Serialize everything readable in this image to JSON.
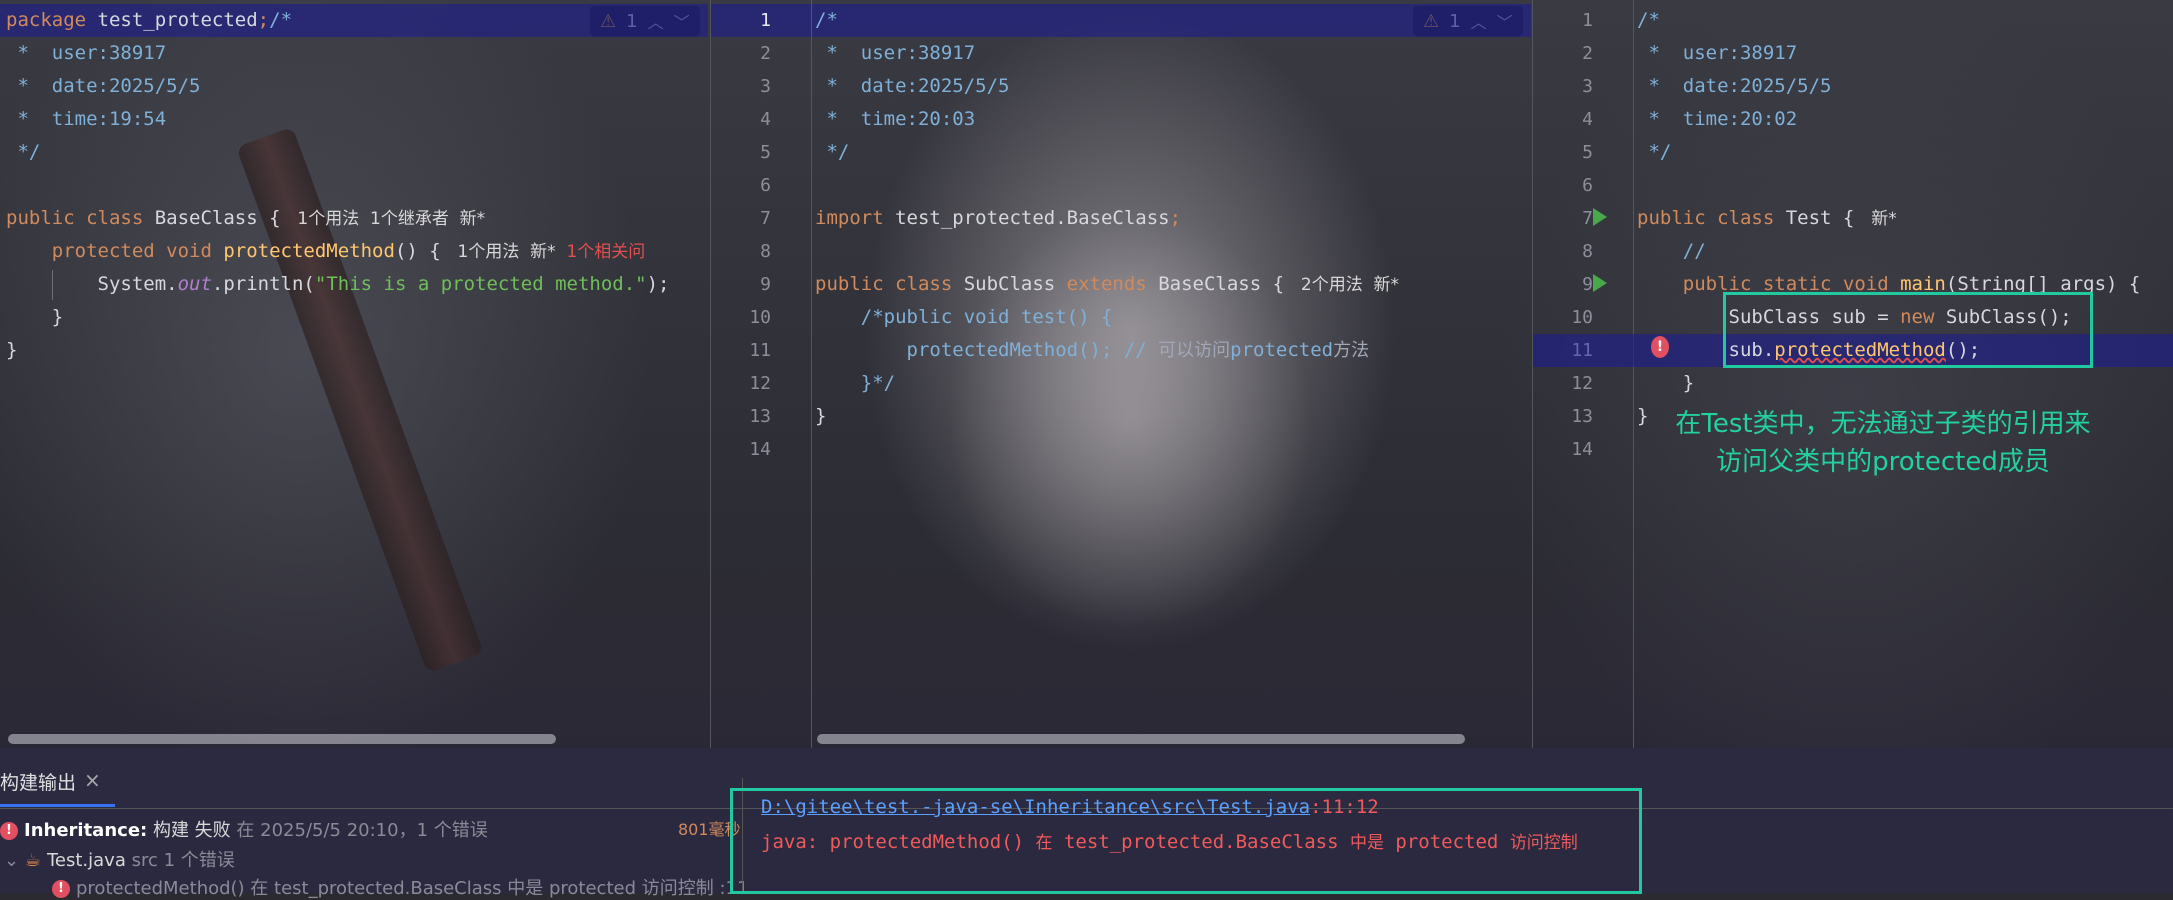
{
  "panes": [
    {
      "id": "baseclass",
      "warning_count": "1",
      "lines": [
        {
          "n": "",
          "segments": [
            [
              "kw",
              "package "
            ],
            [
              "pl",
              "test_protected"
            ],
            [
              "kw",
              ";"
            ],
            [
              "cm",
              "/*"
            ]
          ]
        },
        {
          "n": "",
          "segments": [
            [
              "cm",
              " *  user:38917"
            ]
          ]
        },
        {
          "n": "",
          "segments": [
            [
              "cm",
              " *  date:2025/5/5"
            ]
          ]
        },
        {
          "n": "",
          "segments": [
            [
              "cm",
              " *  time:19:54"
            ]
          ]
        },
        {
          "n": "",
          "segments": [
            [
              "cm",
              " */"
            ]
          ]
        },
        {
          "n": "",
          "segments": []
        },
        {
          "n": "",
          "segments": [
            [
              "kw",
              "public class "
            ],
            [
              "pl",
              "BaseClass { "
            ],
            [
              "hint",
              " 1个用法  1个继承者  新*"
            ]
          ]
        },
        {
          "n": "",
          "segments": [
            [
              "kw",
              "    protected void "
            ],
            [
              "fn",
              "protectedMethod"
            ],
            [
              "pl",
              "() { "
            ],
            [
              "hint",
              " 1个用法  新*"
            ],
            [
              "hintred",
              "  1个相关问"
            ]
          ]
        },
        {
          "n": "",
          "segments": [
            [
              "pl",
              "        System."
            ],
            [
              "it",
              "out"
            ],
            [
              "pl",
              ".println("
            ],
            [
              "st",
              "\"This is a protected method.\""
            ],
            [
              "pl",
              ");"
            ]
          ]
        },
        {
          "n": "",
          "segments": [
            [
              "pl",
              "    }"
            ]
          ]
        },
        {
          "n": "",
          "segments": [
            [
              "pl",
              "}"
            ]
          ]
        }
      ]
    },
    {
      "id": "subclass",
      "warning_count": "1",
      "lines": [
        {
          "n": "1",
          "segments": [
            [
              "cm",
              "/*"
            ]
          ]
        },
        {
          "n": "2",
          "segments": [
            [
              "cm",
              " *  user:38917"
            ]
          ]
        },
        {
          "n": "3",
          "segments": [
            [
              "cm",
              " *  date:2025/5/5"
            ]
          ]
        },
        {
          "n": "4",
          "segments": [
            [
              "cm",
              " *  time:20:03"
            ]
          ]
        },
        {
          "n": "5",
          "segments": [
            [
              "cm",
              " */"
            ]
          ]
        },
        {
          "n": "6",
          "segments": []
        },
        {
          "n": "7",
          "segments": [
            [
              "kw",
              "import "
            ],
            [
              "pl",
              "test_protected.BaseClass"
            ],
            [
              "kw",
              ";"
            ]
          ]
        },
        {
          "n": "8",
          "segments": []
        },
        {
          "n": "9",
          "segments": [
            [
              "kw",
              "public class "
            ],
            [
              "pl",
              "SubClass "
            ],
            [
              "kw",
              "extends "
            ],
            [
              "pl",
              "BaseClass { "
            ],
            [
              "hint",
              " 2个用法  新*"
            ]
          ]
        },
        {
          "n": "10",
          "segments": [
            [
              "cm",
              "    /*public void test() {"
            ]
          ]
        },
        {
          "n": "11",
          "segments": [
            [
              "cm",
              "        protectedMethod(); // "
            ],
            [
              "cjk",
              "可以访问"
            ],
            [
              "cm",
              "protected"
            ],
            [
              "cjk",
              "方法"
            ]
          ]
        },
        {
          "n": "12",
          "segments": [
            [
              "cm",
              "    }*/"
            ]
          ]
        },
        {
          "n": "13",
          "segments": [
            [
              "pl",
              "}"
            ]
          ]
        },
        {
          "n": "14",
          "segments": []
        }
      ]
    },
    {
      "id": "test",
      "lines": [
        {
          "n": "1",
          "segments": [
            [
              "cm",
              "/*"
            ]
          ]
        },
        {
          "n": "2",
          "segments": [
            [
              "cm",
              " *  user:38917"
            ]
          ]
        },
        {
          "n": "3",
          "segments": [
            [
              "cm",
              " *  date:2025/5/5"
            ]
          ]
        },
        {
          "n": "4",
          "segments": [
            [
              "cm",
              " *  time:20:02"
            ]
          ]
        },
        {
          "n": "5",
          "segments": [
            [
              "cm",
              " */"
            ]
          ]
        },
        {
          "n": "6",
          "segments": []
        },
        {
          "n": "7",
          "segments": [
            [
              "kw",
              "public class "
            ],
            [
              "pl",
              "Test { "
            ],
            [
              "hint",
              " 新*"
            ]
          ]
        },
        {
          "n": "8",
          "segments": [
            [
              "cm",
              "    //"
            ]
          ]
        },
        {
          "n": "9",
          "segments": [
            [
              "kw",
              "    public static void "
            ],
            [
              "fn",
              "main"
            ],
            [
              "pl",
              "(String[] args) {"
            ]
          ]
        },
        {
          "n": "10",
          "segments": [
            [
              "pl",
              "        SubClass sub = "
            ],
            [
              "kw",
              "new "
            ],
            [
              "pl",
              "SubClass();"
            ]
          ]
        },
        {
          "n": "11",
          "segments": [
            [
              "pl",
              "        sub."
            ],
            [
              "errtxt",
              "protectedMethod"
            ],
            [
              "pl",
              "();"
            ]
          ]
        },
        {
          "n": "12",
          "segments": [
            [
              "pl",
              "    }"
            ]
          ]
        },
        {
          "n": "13",
          "segments": [
            [
              "pl",
              "}"
            ]
          ]
        },
        {
          "n": "14",
          "segments": []
        }
      ]
    }
  ],
  "annotation": {
    "line1": "在Test类中，无法通过子类的引用来",
    "line2": "访问父类中的protected成员"
  },
  "build": {
    "tab_label": "构建输出",
    "close_glyph": "×",
    "row1_title": "Inheritance:",
    "row1_status": " 构建 失败",
    "row1_detail": " 在 2025/5/5 20:10，1 个错误",
    "row1_time": "801毫秒",
    "row2_file": "Test.java",
    "row2_detail": " src 1 个错误",
    "row3_text": "protectedMethod() 在 test_protected.BaseClass 中是 protected 访问控制 :11",
    "message_path": "D:\\gitee\\test.-java-se\\Inheritance\\src\\Test.java",
    "message_pos": ":11:12",
    "message_err_prefix": "java: protectedMethod() ",
    "message_err_cn1": "在",
    "message_err_mid": " test_protected.BaseClass ",
    "message_err_cn2": "中是",
    "message_err_kw": " protected ",
    "message_err_cn3": "访问控制"
  }
}
